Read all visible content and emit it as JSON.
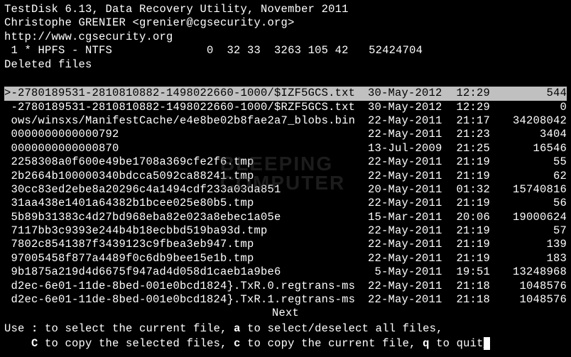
{
  "header": {
    "title": "TestDisk 6.13, Data Recovery Utility, November 2011",
    "author": "Christophe GRENIER <grenier@cgsecurity.org>",
    "url": "http://www.cgsecurity.org",
    "partition": " 1 * HPFS - NTFS              0  32 33  3263 105 42   52424704",
    "mode": "Deleted files"
  },
  "files": [
    {
      "selected": true,
      "prefix": ">",
      "name": "-2780189531-2810810882-1498022660-1000/$IZF5GCS.txt",
      "date": "30-May-2012",
      "time": "12:29",
      "size": "544"
    },
    {
      "selected": false,
      "prefix": " ",
      "name": "-2780189531-2810810882-1498022660-1000/$RZF5GCS.txt",
      "date": "30-May-2012",
      "time": "12:29",
      "size": "0"
    },
    {
      "selected": false,
      "prefix": " ",
      "name": "ows/winsxs/ManifestCache/e4e8be02b8fae2a7_blobs.bin",
      "date": "22-May-2011",
      "time": "21:17",
      "size": "34208042"
    },
    {
      "selected": false,
      "prefix": " ",
      "name": "0000000000000792",
      "date": "22-May-2011",
      "time": "21:23",
      "size": "3404"
    },
    {
      "selected": false,
      "prefix": " ",
      "name": "0000000000000870",
      "date": "13-Jul-2009",
      "time": "21:25",
      "size": "16546"
    },
    {
      "selected": false,
      "prefix": " ",
      "name": "2258308a0f600e49be1708a369cfe2f6.tmp",
      "date": "22-May-2011",
      "time": "21:19",
      "size": "55"
    },
    {
      "selected": false,
      "prefix": " ",
      "name": "2b2664b100000340bdcca5092ca88241.tmp",
      "date": "22-May-2011",
      "time": "21:19",
      "size": "62"
    },
    {
      "selected": false,
      "prefix": " ",
      "name": "30cc83ed2ebe8a20296c4a1494cdf233a03da851",
      "date": "20-May-2011",
      "time": "01:32",
      "size": "15740816"
    },
    {
      "selected": false,
      "prefix": " ",
      "name": "31aa438e1401a64382b1bcee025e80b5.tmp",
      "date": "22-May-2011",
      "time": "21:19",
      "size": "56"
    },
    {
      "selected": false,
      "prefix": " ",
      "name": "5b89b31383c4d27bd968eba82e023a8ebec1a05e",
      "date": "15-Mar-2011",
      "time": "20:06",
      "size": "19000624"
    },
    {
      "selected": false,
      "prefix": " ",
      "name": "7117bb3c9393e244b4b18ecbbd519ba93d.tmp",
      "date": "22-May-2011",
      "time": "21:19",
      "size": "57"
    },
    {
      "selected": false,
      "prefix": " ",
      "name": "7802c8541387f3439123c9fbea3eb947.tmp",
      "date": "22-May-2011",
      "time": "21:19",
      "size": "139"
    },
    {
      "selected": false,
      "prefix": " ",
      "name": "97005458f877a4489f0c6db9bee15e1b.tmp",
      "date": "22-May-2011",
      "time": "21:19",
      "size": "183"
    },
    {
      "selected": false,
      "prefix": " ",
      "name": "9b1875a219d4d6675f947ad4d058d1caeb1a9be6",
      "date": "5-May-2011",
      "time": "19:51",
      "size": "13248968"
    },
    {
      "selected": false,
      "prefix": " ",
      "name": "d2ec-6e01-11de-8bed-001e0bcd1824}.TxR.0.regtrans-ms",
      "date": "22-May-2011",
      "time": "21:18",
      "size": "1048576"
    },
    {
      "selected": false,
      "prefix": " ",
      "name": "d2ec-6e01-11de-8bed-001e0bcd1824}.TxR.1.regtrans-ms",
      "date": "22-May-2011",
      "time": "21:18",
      "size": "1048576"
    }
  ],
  "footer": {
    "next": "Next",
    "help1_pre": "Use ",
    "help1_k1": ":",
    "help1_mid1": " to select the current file, ",
    "help1_k2": "a",
    "help1_mid2": " to select/deselect all files,",
    "help2_pre": "    ",
    "help2_k1": "C",
    "help2_mid1": " to copy the selected files, ",
    "help2_k2": "c",
    "help2_mid2": " to copy the current file, ",
    "help2_k3": "q",
    "help2_mid3": " to quit"
  },
  "watermark": {
    "line1": "BLEEPING",
    "line2": "COMPUTER"
  }
}
